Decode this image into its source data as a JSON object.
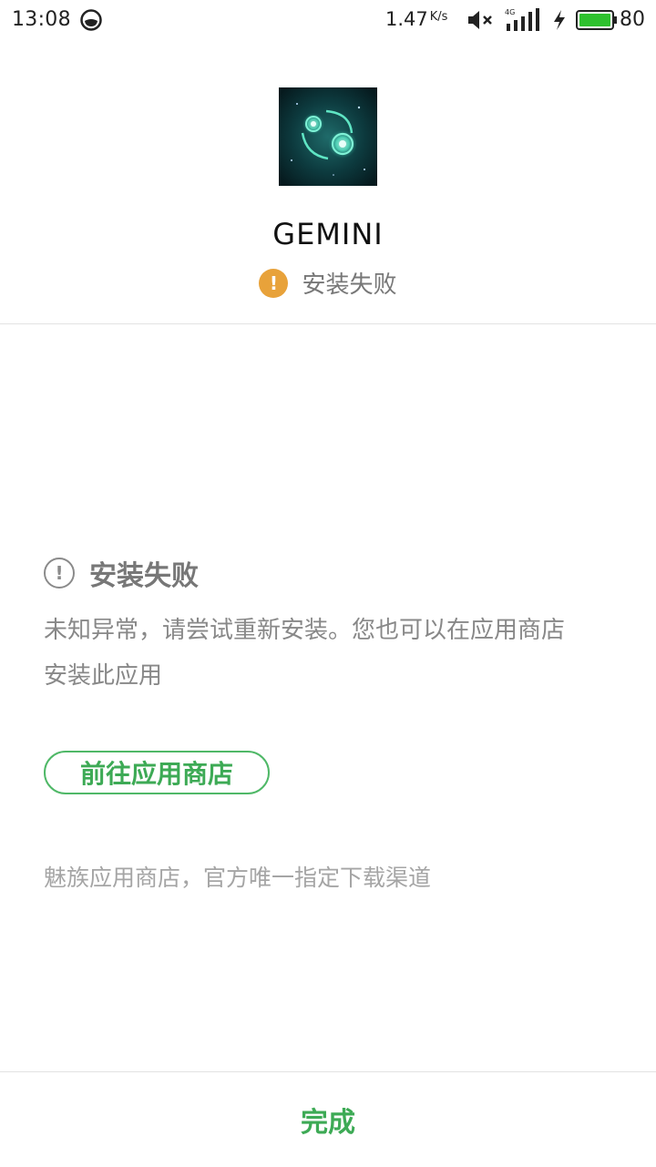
{
  "status_bar": {
    "time": "13:08",
    "app_icon": "browser-circle-icon",
    "network_speed": "1.47",
    "network_speed_unit": "K/s",
    "mute_icon": "volume-mute-icon",
    "signal_icon": "signal-4g-icon",
    "signal_type": "4G",
    "charging_icon": "charging-bolt-icon",
    "battery_level": "80",
    "battery_color": "#2ec12e"
  },
  "app": {
    "icon": "gemini-zodiac-app-icon",
    "name": "GEMINI",
    "status_icon": "warning-icon",
    "status_text": "安装失败",
    "status_color": "#e8a23a"
  },
  "error": {
    "icon": "info-icon",
    "title": "安装失败",
    "message_line1": "未知异常，请尝试重新安装。您也可以在应用商店",
    "message_line2": "安装此应用"
  },
  "actions": {
    "store_button_label": "前往应用商店",
    "footnote": "魅族应用商店，官方唯一指定下载渠道",
    "done_label": "完成",
    "accent_color": "#3daa55"
  }
}
